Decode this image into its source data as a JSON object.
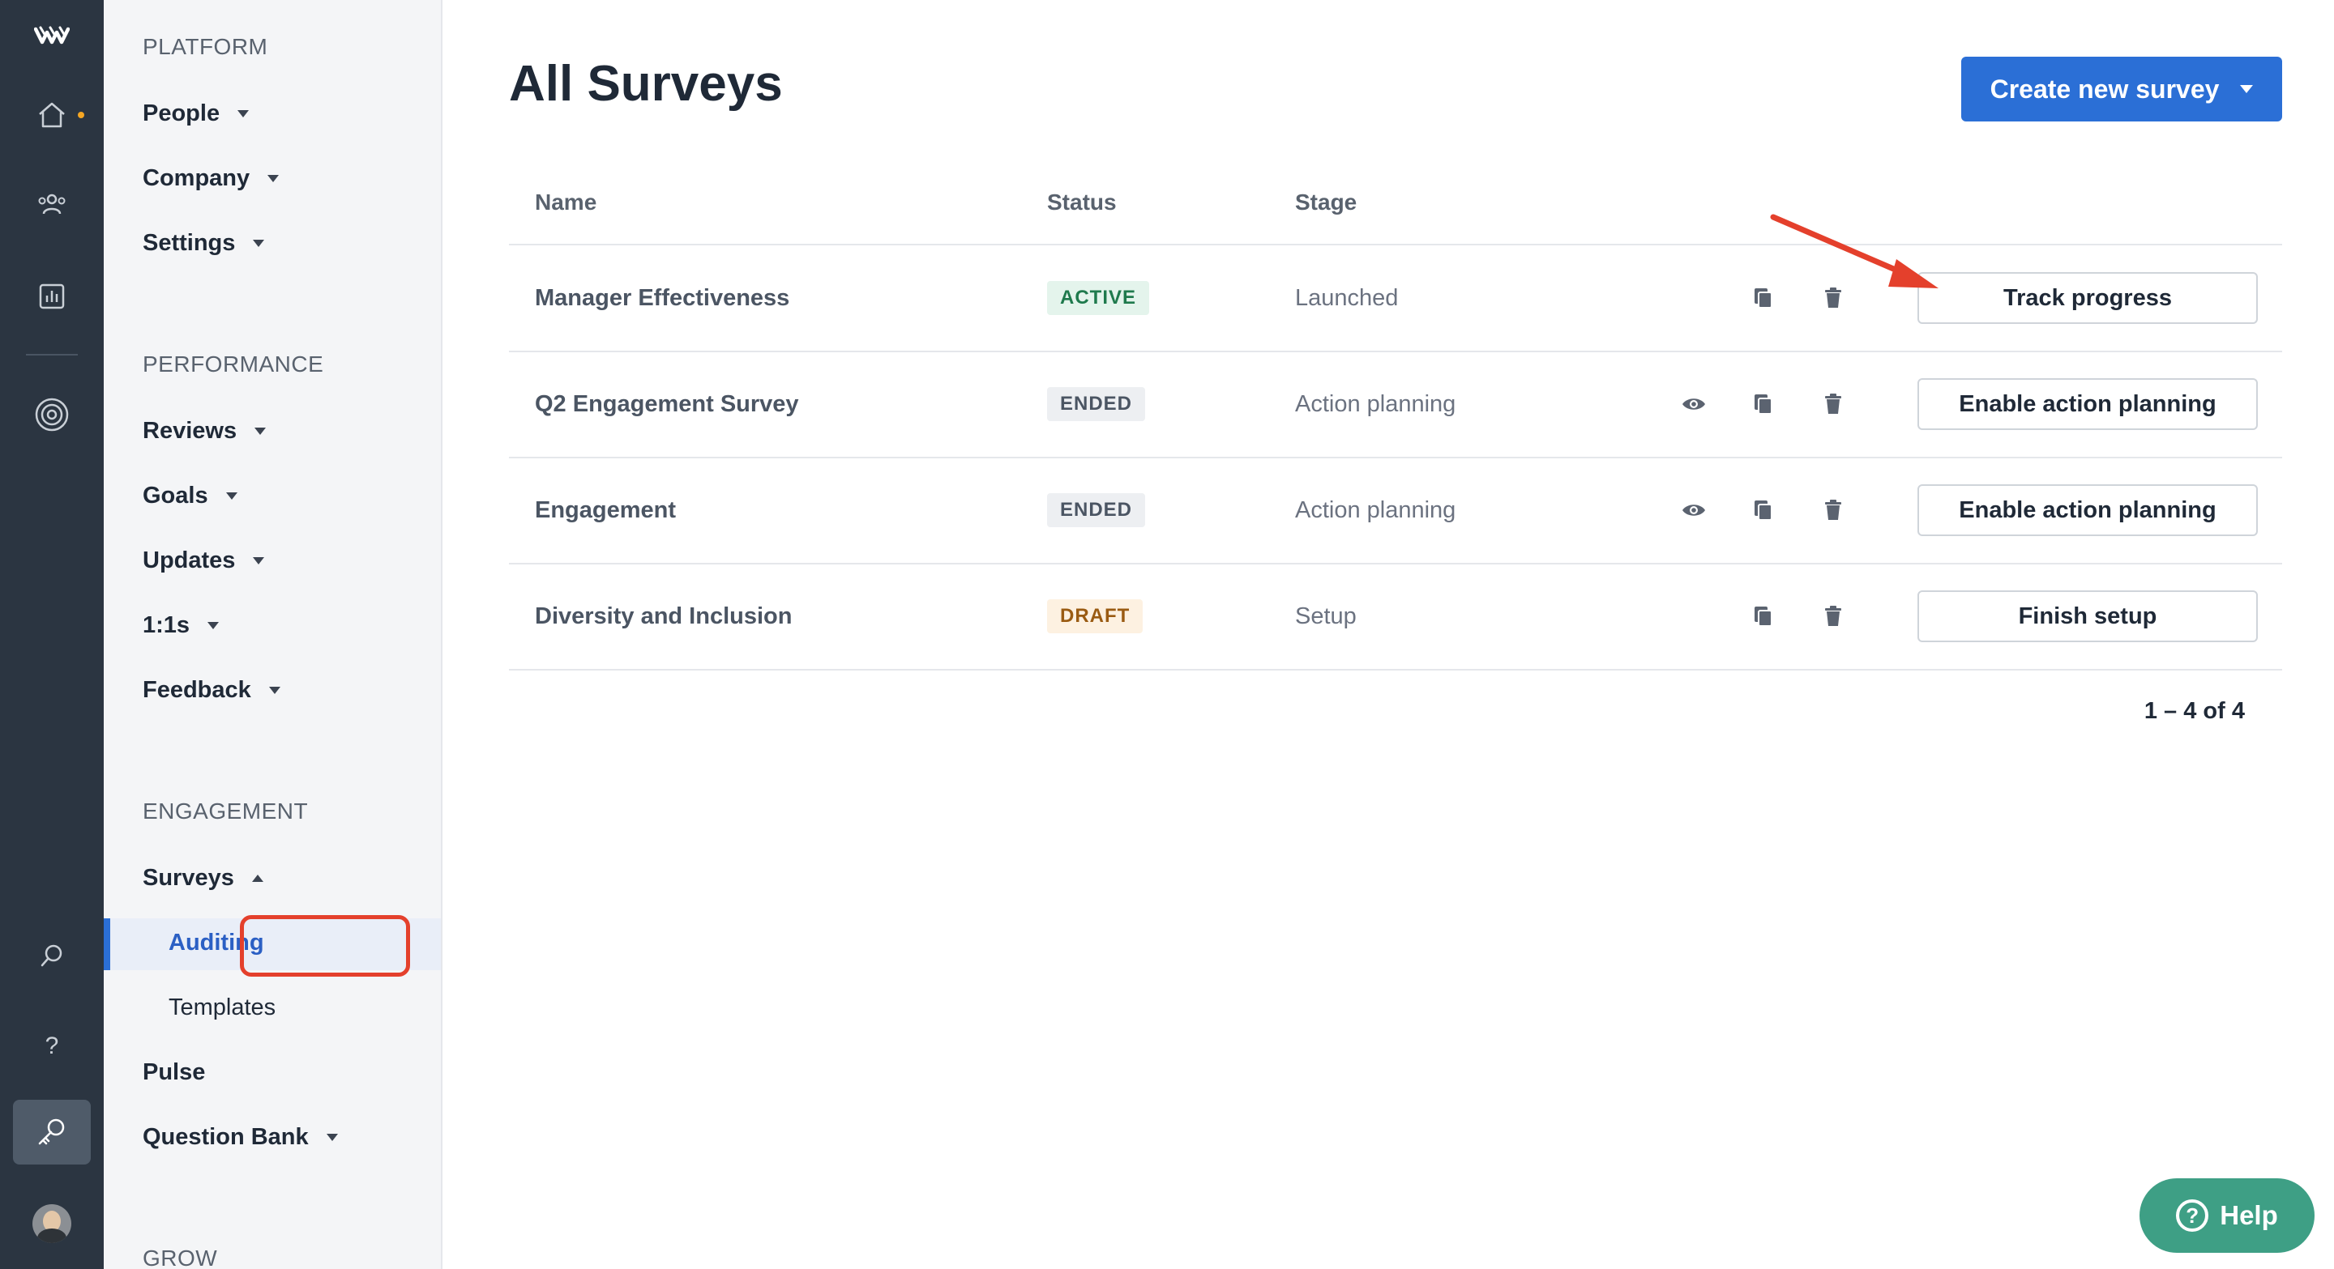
{
  "rail": {
    "icons": [
      "logo-icon",
      "home-icon",
      "people-icon",
      "chart-icon",
      "target-icon",
      "search-icon",
      "help-icon",
      "key-icon",
      "avatar"
    ],
    "help_glyph": "?"
  },
  "sidebar": {
    "platform": {
      "title": "PLATFORM",
      "items": [
        {
          "label": "People"
        },
        {
          "label": "Company"
        },
        {
          "label": "Settings"
        }
      ]
    },
    "performance": {
      "title": "PERFORMANCE",
      "items": [
        {
          "label": "Reviews"
        },
        {
          "label": "Goals"
        },
        {
          "label": "Updates"
        },
        {
          "label": "1:1s"
        },
        {
          "label": "Feedback"
        }
      ]
    },
    "engagement": {
      "title": "ENGAGEMENT",
      "surveys": "Surveys",
      "surveys_sub": [
        {
          "label": "Auditing",
          "active": true
        },
        {
          "label": "Templates"
        }
      ],
      "pulse": "Pulse",
      "question_bank": "Question Bank"
    },
    "grow": {
      "title": "GROW"
    }
  },
  "main": {
    "title": "All Surveys",
    "create_button": "Create new survey",
    "columns": {
      "name": "Name",
      "status": "Status",
      "stage": "Stage"
    },
    "rows": [
      {
        "name": "Manager Effectiveness",
        "status": "ACTIVE",
        "status_kind": "active",
        "stage": "Launched",
        "action": "Track progress",
        "has_view": false
      },
      {
        "name": "Q2 Engagement Survey",
        "status": "ENDED",
        "status_kind": "ended",
        "stage": "Action planning",
        "action": "Enable action planning",
        "has_view": true
      },
      {
        "name": "Engagement",
        "status": "ENDED",
        "status_kind": "ended",
        "stage": "Action planning",
        "action": "Enable action planning",
        "has_view": true
      },
      {
        "name": "Diversity and Inclusion",
        "status": "DRAFT",
        "status_kind": "draft",
        "stage": "Setup",
        "action": "Finish setup",
        "has_view": false
      }
    ],
    "pagination": "1 – 4 of 4"
  },
  "help_button": "Help",
  "colors": {
    "rail_bg": "#2b3541",
    "sidebar_bg": "#f4f5f7",
    "primary": "#2b6fd6",
    "annotation_red": "#e4402c",
    "help_green": "#3e9f85"
  }
}
